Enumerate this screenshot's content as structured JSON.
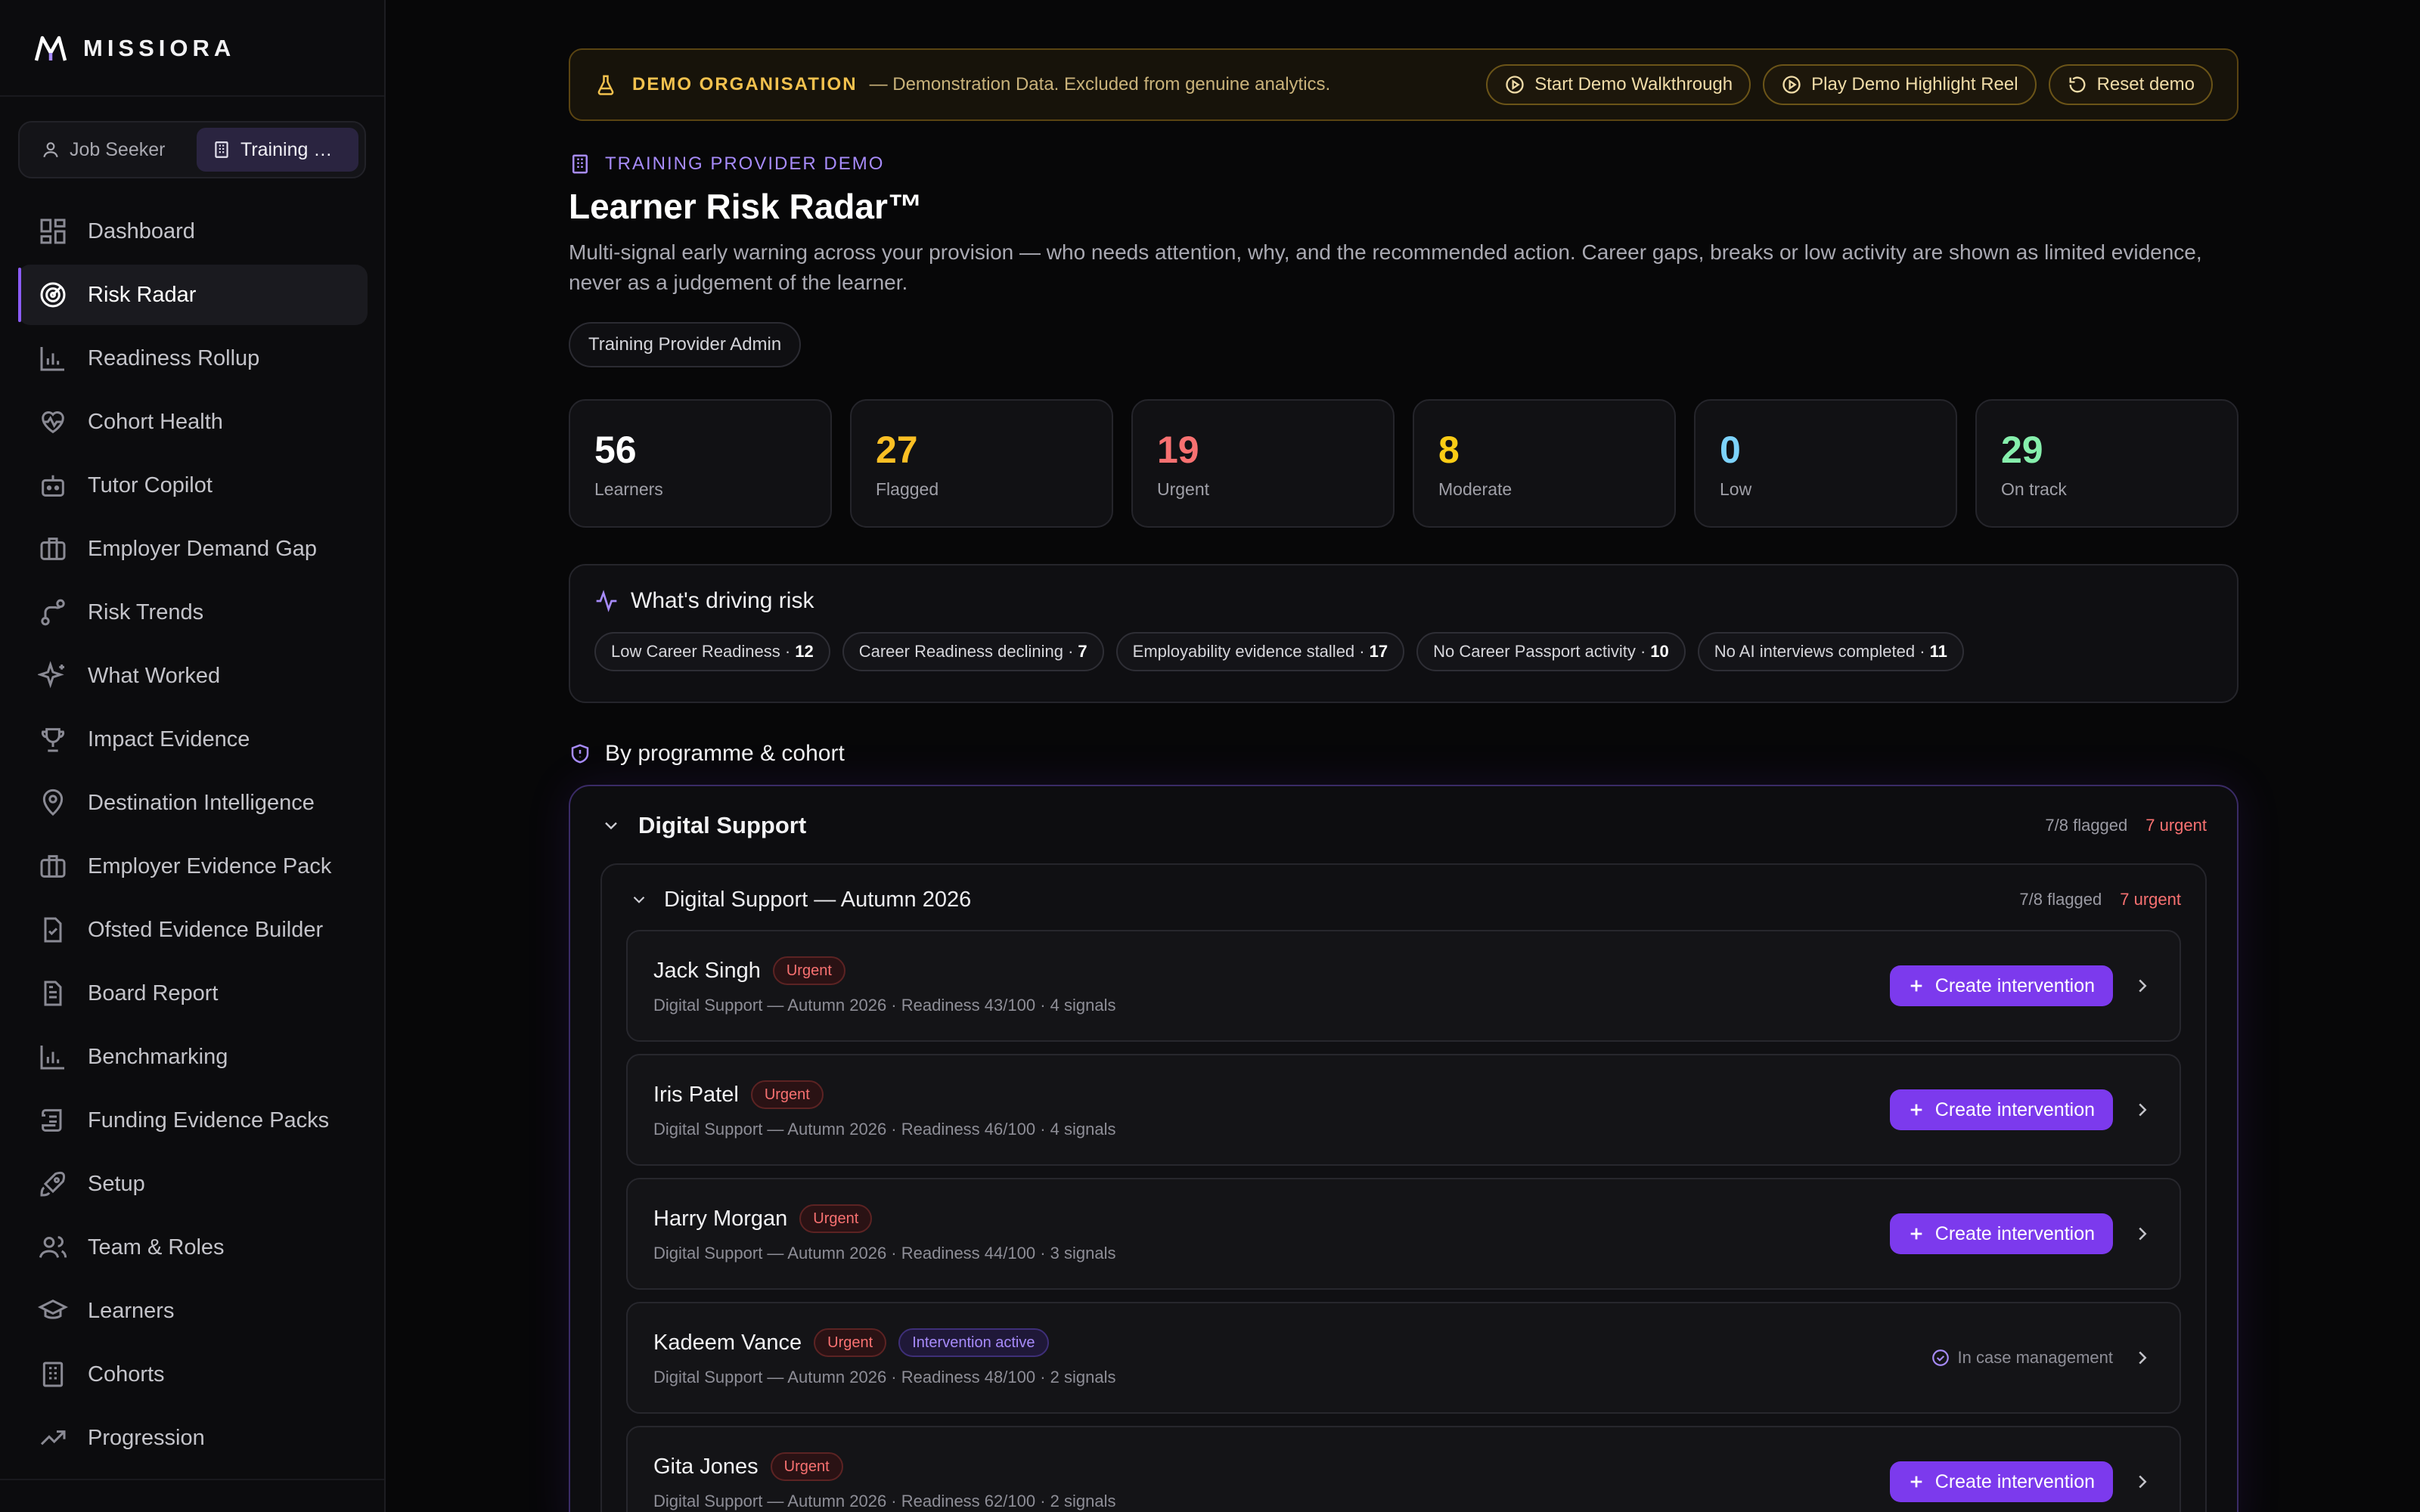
{
  "brand": {
    "name": "MISSIORA"
  },
  "switcher": {
    "job_seeker": "Job Seeker",
    "training_provider": "Training Pro..."
  },
  "nav": [
    {
      "label": "Dashboard",
      "icon": "dashboard-icon"
    },
    {
      "label": "Risk Radar",
      "icon": "radar-icon"
    },
    {
      "label": "Readiness Rollup",
      "icon": "bar-chart-icon"
    },
    {
      "label": "Cohort Health",
      "icon": "heart-pulse-icon"
    },
    {
      "label": "Tutor Copilot",
      "icon": "bot-icon"
    },
    {
      "label": "Employer Demand Gap",
      "icon": "briefcase-icon"
    },
    {
      "label": "Risk Trends",
      "icon": "route-icon"
    },
    {
      "label": "What Worked",
      "icon": "sparkles-icon"
    },
    {
      "label": "Impact Evidence",
      "icon": "trophy-icon"
    },
    {
      "label": "Destination Intelligence",
      "icon": "map-pin-icon"
    },
    {
      "label": "Employer Evidence Pack",
      "icon": "briefcase-icon"
    },
    {
      "label": "Ofsted Evidence Builder",
      "icon": "file-check-icon"
    },
    {
      "label": "Board Report",
      "icon": "file-text-icon"
    },
    {
      "label": "Benchmarking",
      "icon": "bar-chart-icon"
    },
    {
      "label": "Funding Evidence Packs",
      "icon": "scroll-icon"
    },
    {
      "label": "Setup",
      "icon": "rocket-icon"
    },
    {
      "label": "Team & Roles",
      "icon": "users-icon"
    },
    {
      "label": "Learners",
      "icon": "graduation-cap-icon"
    },
    {
      "label": "Cohorts",
      "icon": "building-icon"
    },
    {
      "label": "Progression",
      "icon": "trending-up-icon"
    }
  ],
  "banner": {
    "tag": "DEMO ORGANISATION",
    "desc": "— Demonstration Data. Excluded from genuine analytics.",
    "walkthrough": "Start Demo Walkthrough",
    "highlight": "Play Demo Highlight Reel",
    "reset": "Reset demo"
  },
  "header": {
    "kicker": "TRAINING PROVIDER DEMO",
    "title": "Learner Risk Radar™",
    "subtitle": "Multi-signal early warning across your provision — who needs attention, why, and the recommended action. Career gaps, breaks or low activity are shown as limited evidence, never as a judgement of the learner.",
    "role": "Training Provider Admin"
  },
  "stats": [
    {
      "value": "56",
      "label": "Learners",
      "color": "#ffffff"
    },
    {
      "value": "27",
      "label": "Flagged",
      "color": "#fbbf24"
    },
    {
      "value": "19",
      "label": "Urgent",
      "color": "#f87171"
    },
    {
      "value": "8",
      "label": "Moderate",
      "color": "#facc15"
    },
    {
      "value": "0",
      "label": "Low",
      "color": "#7dd3fc"
    },
    {
      "value": "29",
      "label": "On track",
      "color": "#86efac"
    }
  ],
  "drivers": {
    "title": "What's driving risk",
    "chips": [
      {
        "label": "Low Career Readiness ·",
        "count": "12"
      },
      {
        "label": "Career Readiness declining ·",
        "count": "7"
      },
      {
        "label": "Employability evidence stalled ·",
        "count": "17"
      },
      {
        "label": "No Career Passport activity ·",
        "count": "10"
      },
      {
        "label": "No AI interviews completed ·",
        "count": "11"
      }
    ]
  },
  "section": {
    "title": "By programme & cohort"
  },
  "programme": {
    "title": "Digital Support",
    "flagged": "7/8 flagged",
    "urgent": "7 urgent",
    "cohort": {
      "title": "Digital Support — Autumn 2026",
      "flagged": "7/8 flagged",
      "urgent": "7 urgent",
      "learners": [
        {
          "name": "Jack Singh",
          "badge": "Urgent",
          "meta": "Digital Support — Autumn 2026 · Readiness 43/100 · 4 signals",
          "action": "Create intervention"
        },
        {
          "name": "Iris Patel",
          "badge": "Urgent",
          "meta": "Digital Support — Autumn 2026 · Readiness 46/100 · 4 signals",
          "action": "Create intervention"
        },
        {
          "name": "Harry Morgan",
          "badge": "Urgent",
          "meta": "Digital Support — Autumn 2026 · Readiness 44/100 · 3 signals",
          "action": "Create intervention"
        },
        {
          "name": "Kadeem Vance",
          "badge": "Urgent",
          "badge2": "Intervention active",
          "meta": "Digital Support — Autumn 2026 · Readiness 48/100 · 2 signals",
          "status": "In case management"
        },
        {
          "name": "Gita Jones",
          "badge": "Urgent",
          "meta": "Digital Support — Autumn 2026 · Readiness 62/100 · 2 signals",
          "action": "Create intervention"
        }
      ]
    }
  }
}
